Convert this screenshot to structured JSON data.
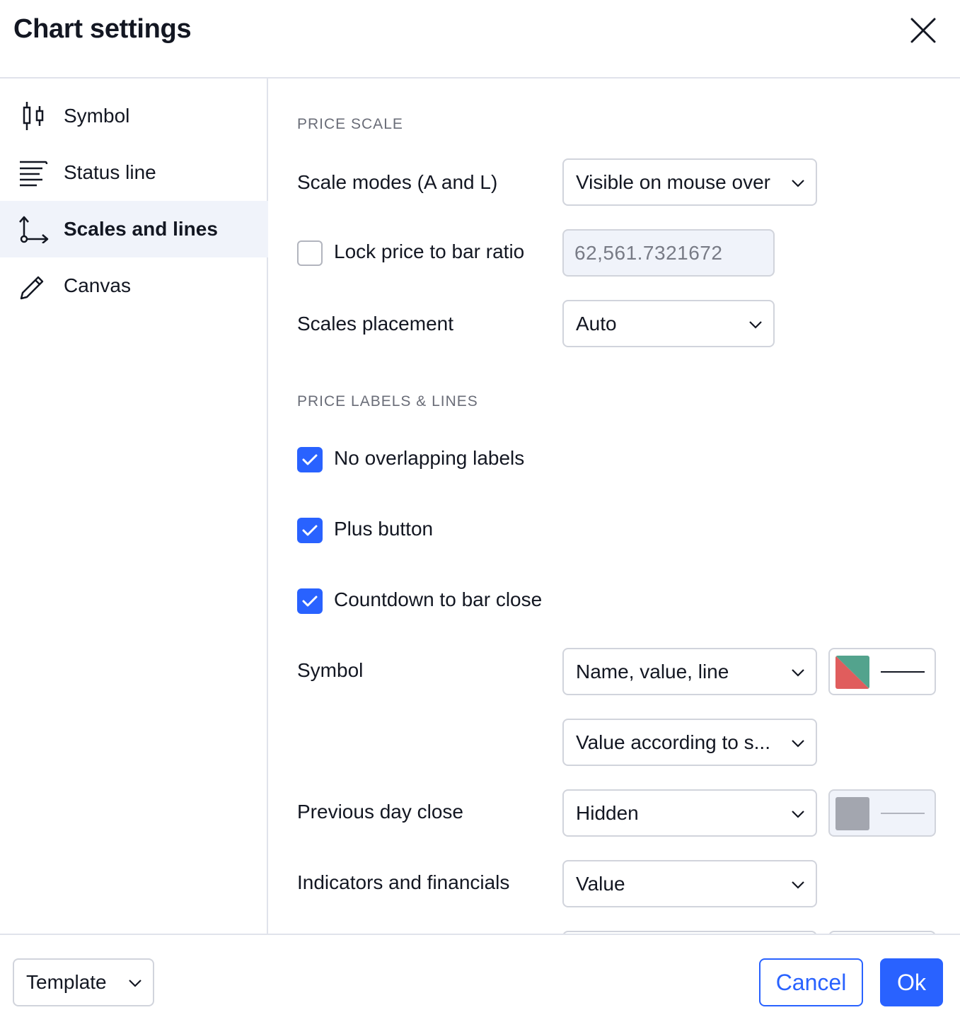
{
  "dialog": {
    "title": "Chart settings",
    "close_icon": "close-icon"
  },
  "sidebar": {
    "items": [
      {
        "label": "Symbol",
        "icon": "candlestick-icon",
        "active": false
      },
      {
        "label": "Status line",
        "icon": "status-line-icon",
        "active": false
      },
      {
        "label": "Scales and lines",
        "icon": "scales-axes-icon",
        "active": true
      },
      {
        "label": "Canvas",
        "icon": "pencil-icon",
        "active": false
      }
    ]
  },
  "content": {
    "price_scale": {
      "title": "PRICE SCALE",
      "scale_modes": {
        "label": "Scale modes (A and L)",
        "value": "Visible on mouse over"
      },
      "lock_ratio": {
        "label": "Lock price to bar ratio",
        "checked": false,
        "value": "62,561.7321672"
      },
      "placement": {
        "label": "Scales placement",
        "value": "Auto"
      }
    },
    "price_labels": {
      "title": "PRICE LABELS & LINES",
      "no_overlapping": {
        "label": "No overlapping labels",
        "checked": true
      },
      "plus_button": {
        "label": "Plus button",
        "checked": true
      },
      "countdown": {
        "label": "Countdown to bar close",
        "checked": true
      },
      "symbol": {
        "label": "Symbol",
        "value": "Name, value, line",
        "value2": "Value according to s...",
        "colors": [
          "#e05d5d",
          "#53a38d"
        ],
        "line_color": "#131722"
      },
      "prev_day_close": {
        "label": "Previous day close",
        "value": "Hidden",
        "color": "#a3a6af",
        "line_color": "#b2b5be"
      },
      "indicators": {
        "label": "Indicators and financials",
        "value": "Value"
      }
    }
  },
  "footer": {
    "template_label": "Template",
    "cancel_label": "Cancel",
    "ok_label": "Ok"
  },
  "colors": {
    "accent": "#2962ff",
    "border": "#d1d4dc",
    "active_bg": "#f0f3fa"
  }
}
